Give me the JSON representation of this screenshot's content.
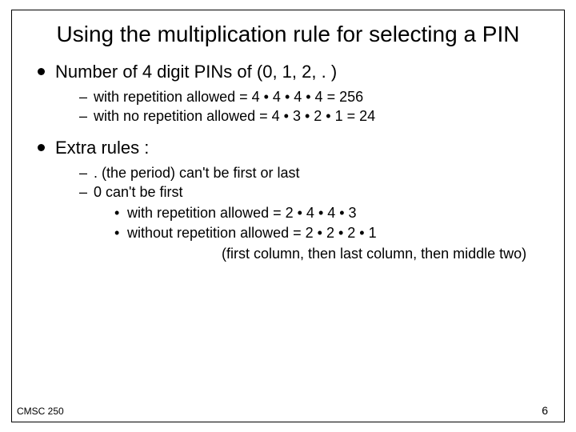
{
  "title": "Using the multiplication rule for selecting a PIN",
  "bullets": [
    {
      "text": "Number of 4 digit PINs of (0, 1, 2, . )",
      "subs": [
        {
          "text": "with repetition allowed = 4 • 4  • 4 • 4 = 256"
        },
        {
          "text": "with no repetition allowed = 4 • 3 • 2 • 1 = 24"
        }
      ]
    },
    {
      "text": "Extra rules :",
      "subs": [
        {
          "text": ". (the period) can't be first or last"
        },
        {
          "text": "0 can't be first",
          "subs": [
            {
              "text": "with repetition allowed = 2 • 4 • 4 • 3"
            },
            {
              "text": "without repetition allowed = 2 • 2 • 2 • 1"
            }
          ],
          "note": "(first column, then last column, then middle two)"
        }
      ]
    }
  ],
  "footer": {
    "left": "CMSC 250",
    "right": "6"
  }
}
